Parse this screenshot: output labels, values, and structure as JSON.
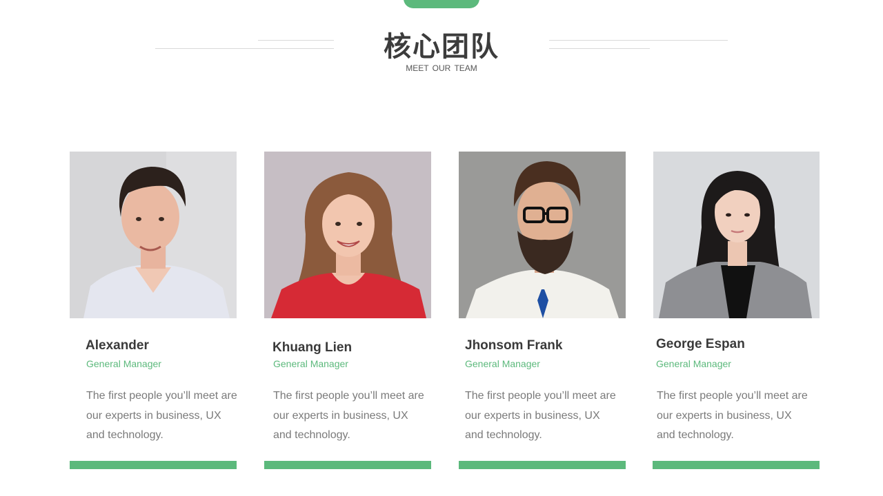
{
  "header": {
    "title": "核心团队",
    "subtitle": "MEET  OUR TEAM"
  },
  "accent_color": "#5cb97c",
  "team": [
    {
      "name": "Alexander",
      "role": "General Manager",
      "description": "The first people you’ll meet are our experts in business, UX and technology."
    },
    {
      "name": "Khuang Lien",
      "role": "General Manager",
      "description": "The first people you’ll meet are our experts in business, UX and technology."
    },
    {
      "name": "Jhonsom Frank",
      "role": "General Manager",
      "description": "The first people you’ll meet are our experts in business, UX and technology."
    },
    {
      "name": "George Espan",
      "role": "General Manager",
      "description": "The first people you’ll meet are our experts in business, UX and technology."
    }
  ]
}
